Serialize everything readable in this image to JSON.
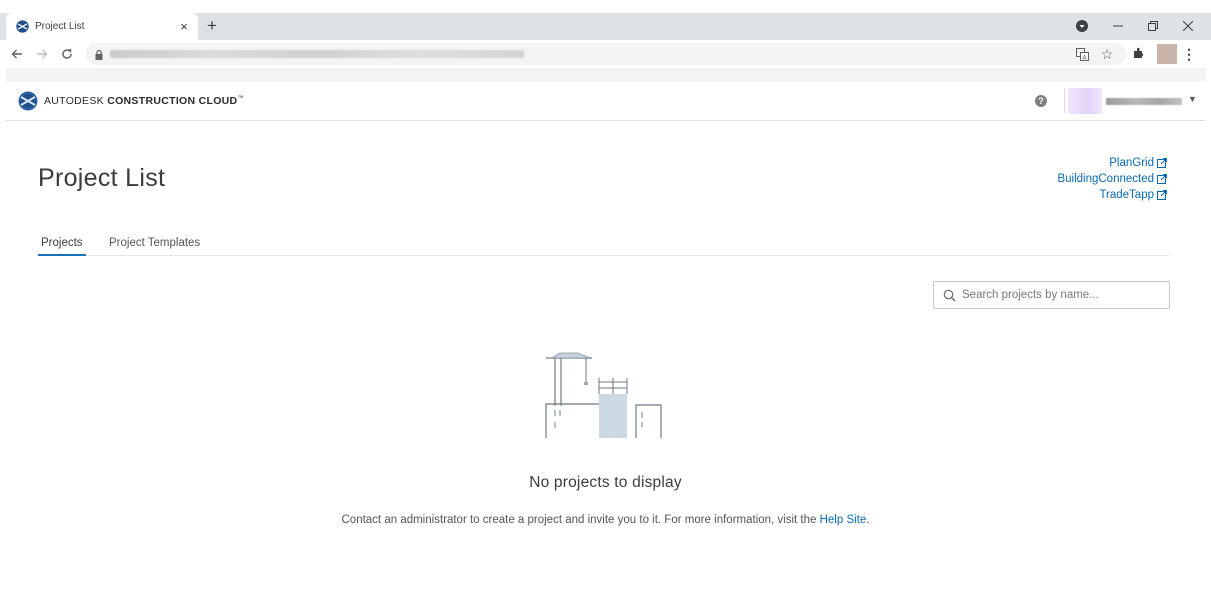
{
  "browser": {
    "tab_title": "Project List",
    "tab_close": "×",
    "new_tab": "+"
  },
  "app": {
    "brand_light": "AUTODESK",
    "brand_bold": "CONSTRUCTION CLOUD",
    "brand_mark": "™"
  },
  "page": {
    "title": "Project List",
    "external_links": [
      "PlanGrid",
      "BuildingConnected",
      "TradeTapp"
    ],
    "tabs": [
      "Projects",
      "Project Templates"
    ],
    "search_placeholder": "Search projects by name...",
    "empty_title": "No projects to display",
    "empty_desc_prefix": "Contact an administrator to create a project and invite you to it. For more information, visit the ",
    "empty_desc_link": "Help Site",
    "empty_desc_suffix": "."
  },
  "colors": {
    "accent": "#1a72bb",
    "link": "#0a6bb5"
  }
}
